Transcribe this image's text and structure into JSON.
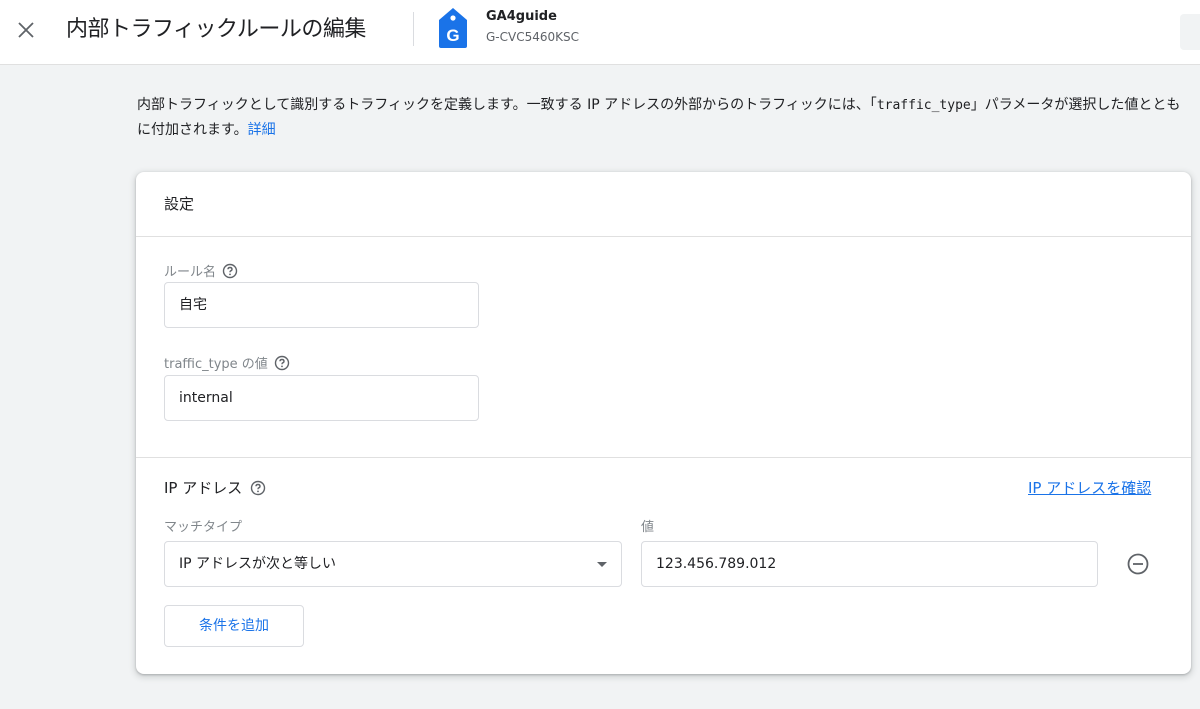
{
  "header": {
    "title": "内部トラフィックルールの編集",
    "property_name": "GA4guide",
    "property_id": "G-CVC5460KSC",
    "tag_letter": "G"
  },
  "description": {
    "text_before": "内部トラフィックとして識別するトラフィックを定義します。一致する IP アドレスの外部からのトラフィックには、「",
    "code": "traffic_type",
    "text_after": "」パラメータが選択した値とともに付加されます。",
    "link": "詳細"
  },
  "card": {
    "title": "設定",
    "rule_name": {
      "label": "ルール名",
      "value": "自宅"
    },
    "traffic_type": {
      "label": "traffic_type の値",
      "value": "internal"
    },
    "ip_section": {
      "title": "IP アドレス",
      "verify_link": "IP アドレスを確認",
      "match_type_label": "マッチタイプ",
      "value_label": "値",
      "match_type_value": "IP アドレスが次と等しい",
      "ip_value": "123.456.789.012",
      "add_condition": "条件を追加"
    }
  },
  "colors": {
    "accent": "#1a73e8",
    "background": "#f1f3f4",
    "border": "#dadce0"
  }
}
